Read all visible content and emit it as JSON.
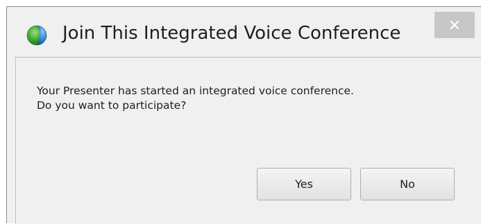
{
  "window": {
    "title": "Join This Integrated Voice Conference",
    "app_icon": "globe-icon",
    "close_icon": "close-icon"
  },
  "dialog": {
    "message_line1": "Your Presenter has started an integrated voice conference.",
    "message_line2": "Do you want to participate?",
    "yes_label": "Yes",
    "no_label": "No"
  },
  "colors": {
    "background": "#f0f0f0",
    "close_button": "#c7c7c7",
    "button_border": "#adadad",
    "icon_green": "#4caf3a",
    "icon_blue": "#2a7fd4"
  }
}
